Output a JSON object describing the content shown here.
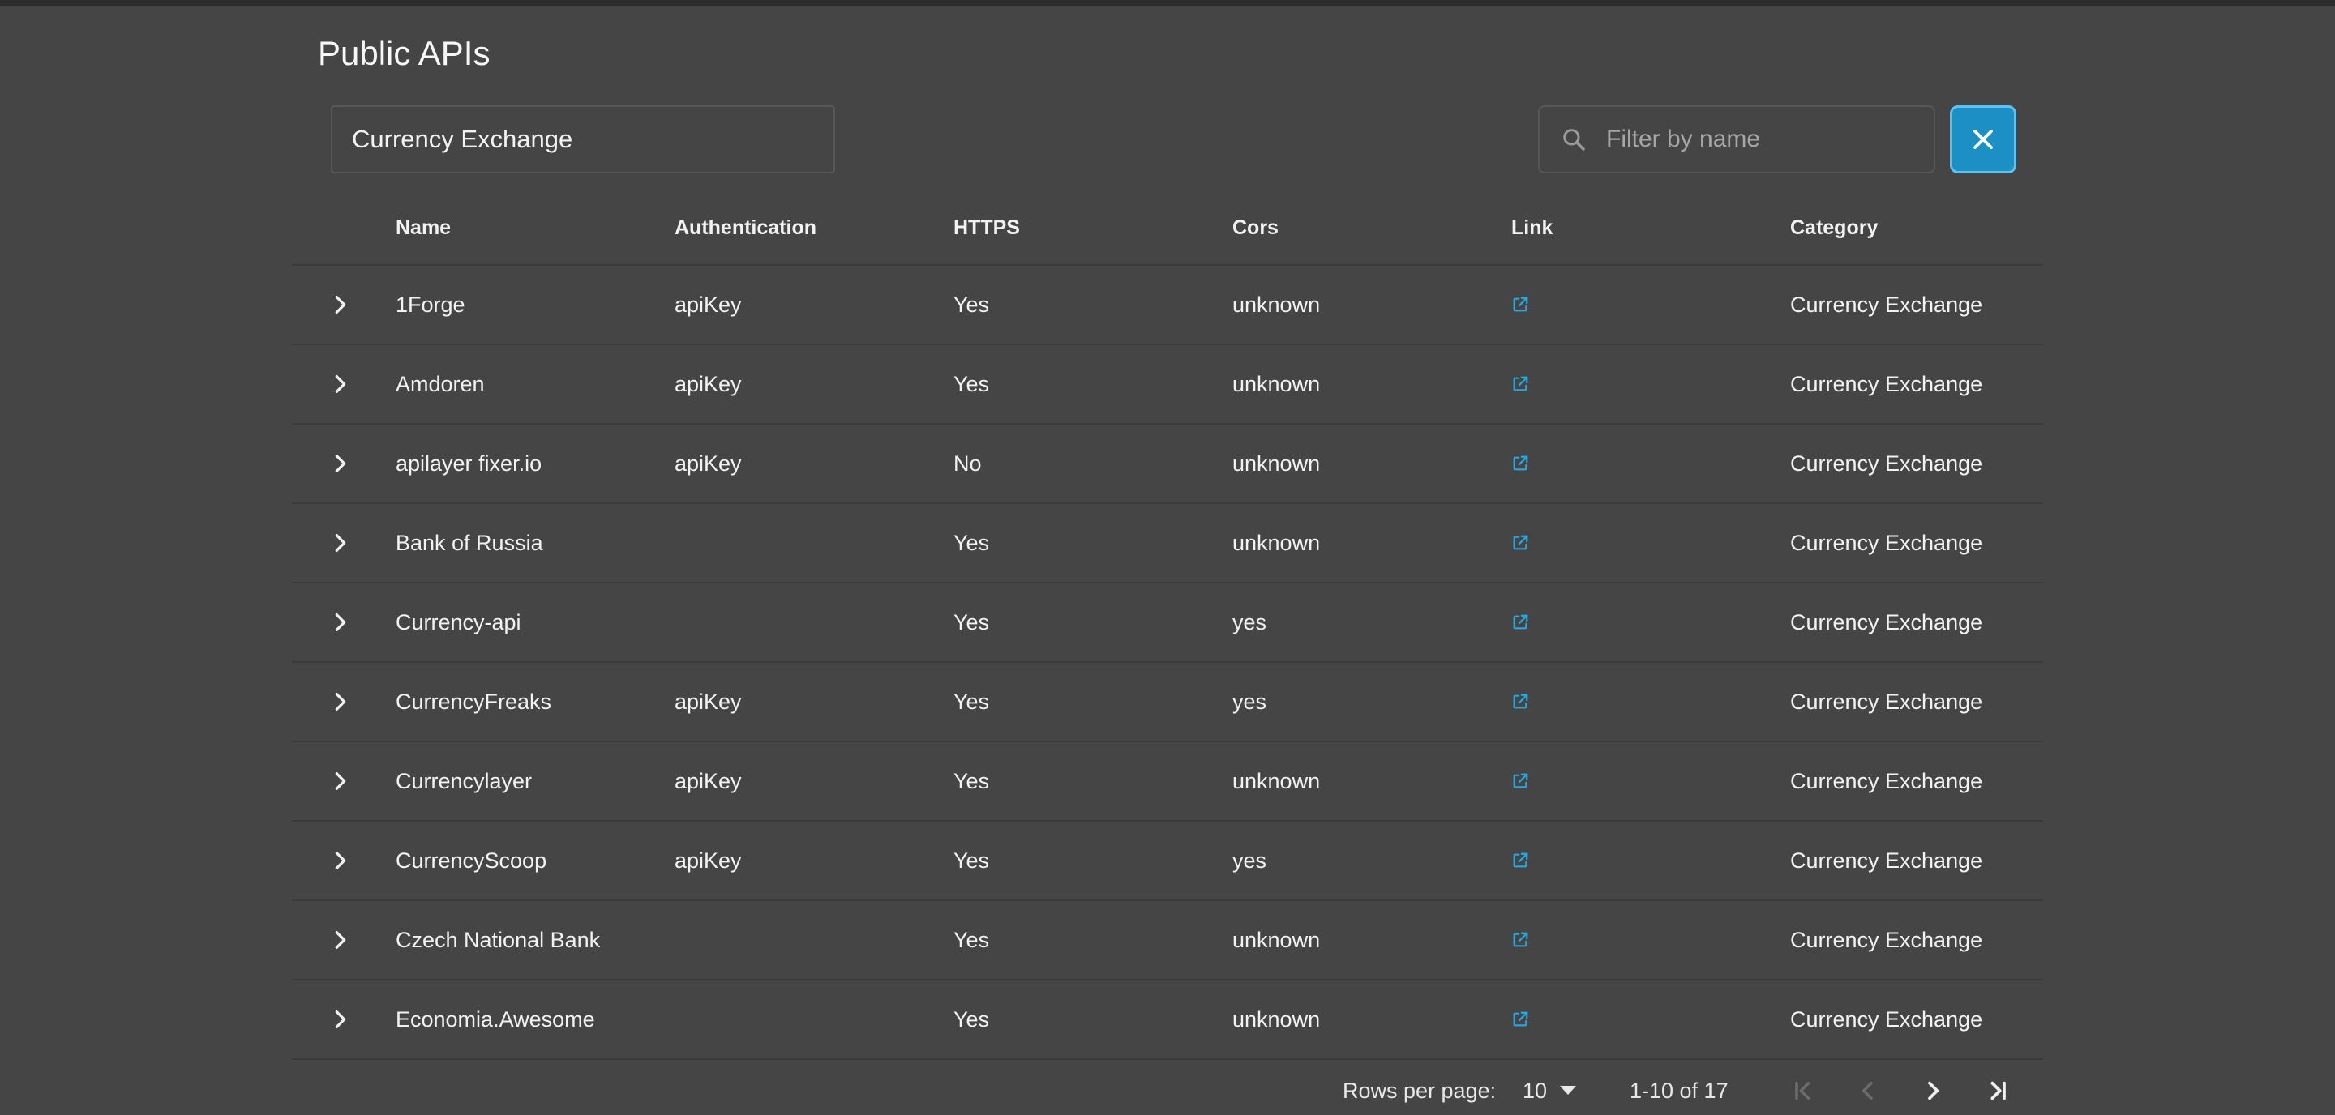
{
  "page": {
    "title": "Public APIs"
  },
  "filters": {
    "category_value": "Currency Exchange",
    "search_placeholder": "Filter by name",
    "search_value": ""
  },
  "icons": {
    "search": "search-icon",
    "clear": "close-icon",
    "expand": "chevron-right-icon",
    "link": "external-link-icon",
    "first": "first-page-icon",
    "prev": "chevron-left-icon",
    "next": "chevron-right-icon",
    "last": "last-page-icon",
    "dropdown": "caret-down-icon"
  },
  "colors": {
    "background": "#454545",
    "accent": "#1c90c4",
    "link": "#29a8e0"
  },
  "table": {
    "columns": [
      "Name",
      "Authentication",
      "HTTPS",
      "Cors",
      "Link",
      "Category"
    ],
    "rows": [
      {
        "name": "1Forge",
        "auth": "apiKey",
        "https": "Yes",
        "cors": "unknown",
        "category": "Currency Exchange"
      },
      {
        "name": "Amdoren",
        "auth": "apiKey",
        "https": "Yes",
        "cors": "unknown",
        "category": "Currency Exchange"
      },
      {
        "name": "apilayer fixer.io",
        "auth": "apiKey",
        "https": "No",
        "cors": "unknown",
        "category": "Currency Exchange"
      },
      {
        "name": "Bank of Russia",
        "auth": "",
        "https": "Yes",
        "cors": "unknown",
        "category": "Currency Exchange"
      },
      {
        "name": "Currency-api",
        "auth": "",
        "https": "Yes",
        "cors": "yes",
        "category": "Currency Exchange"
      },
      {
        "name": "CurrencyFreaks",
        "auth": "apiKey",
        "https": "Yes",
        "cors": "yes",
        "category": "Currency Exchange"
      },
      {
        "name": "Currencylayer",
        "auth": "apiKey",
        "https": "Yes",
        "cors": "unknown",
        "category": "Currency Exchange"
      },
      {
        "name": "CurrencyScoop",
        "auth": "apiKey",
        "https": "Yes",
        "cors": "yes",
        "category": "Currency Exchange"
      },
      {
        "name": "Czech National Bank",
        "auth": "",
        "https": "Yes",
        "cors": "unknown",
        "category": "Currency Exchange"
      },
      {
        "name": "Economia.Awesome",
        "auth": "",
        "https": "Yes",
        "cors": "unknown",
        "category": "Currency Exchange"
      }
    ]
  },
  "pagination": {
    "rows_per_page_label": "Rows per page:",
    "rows_per_page_value": "10",
    "range_label": "1-10 of 17"
  }
}
